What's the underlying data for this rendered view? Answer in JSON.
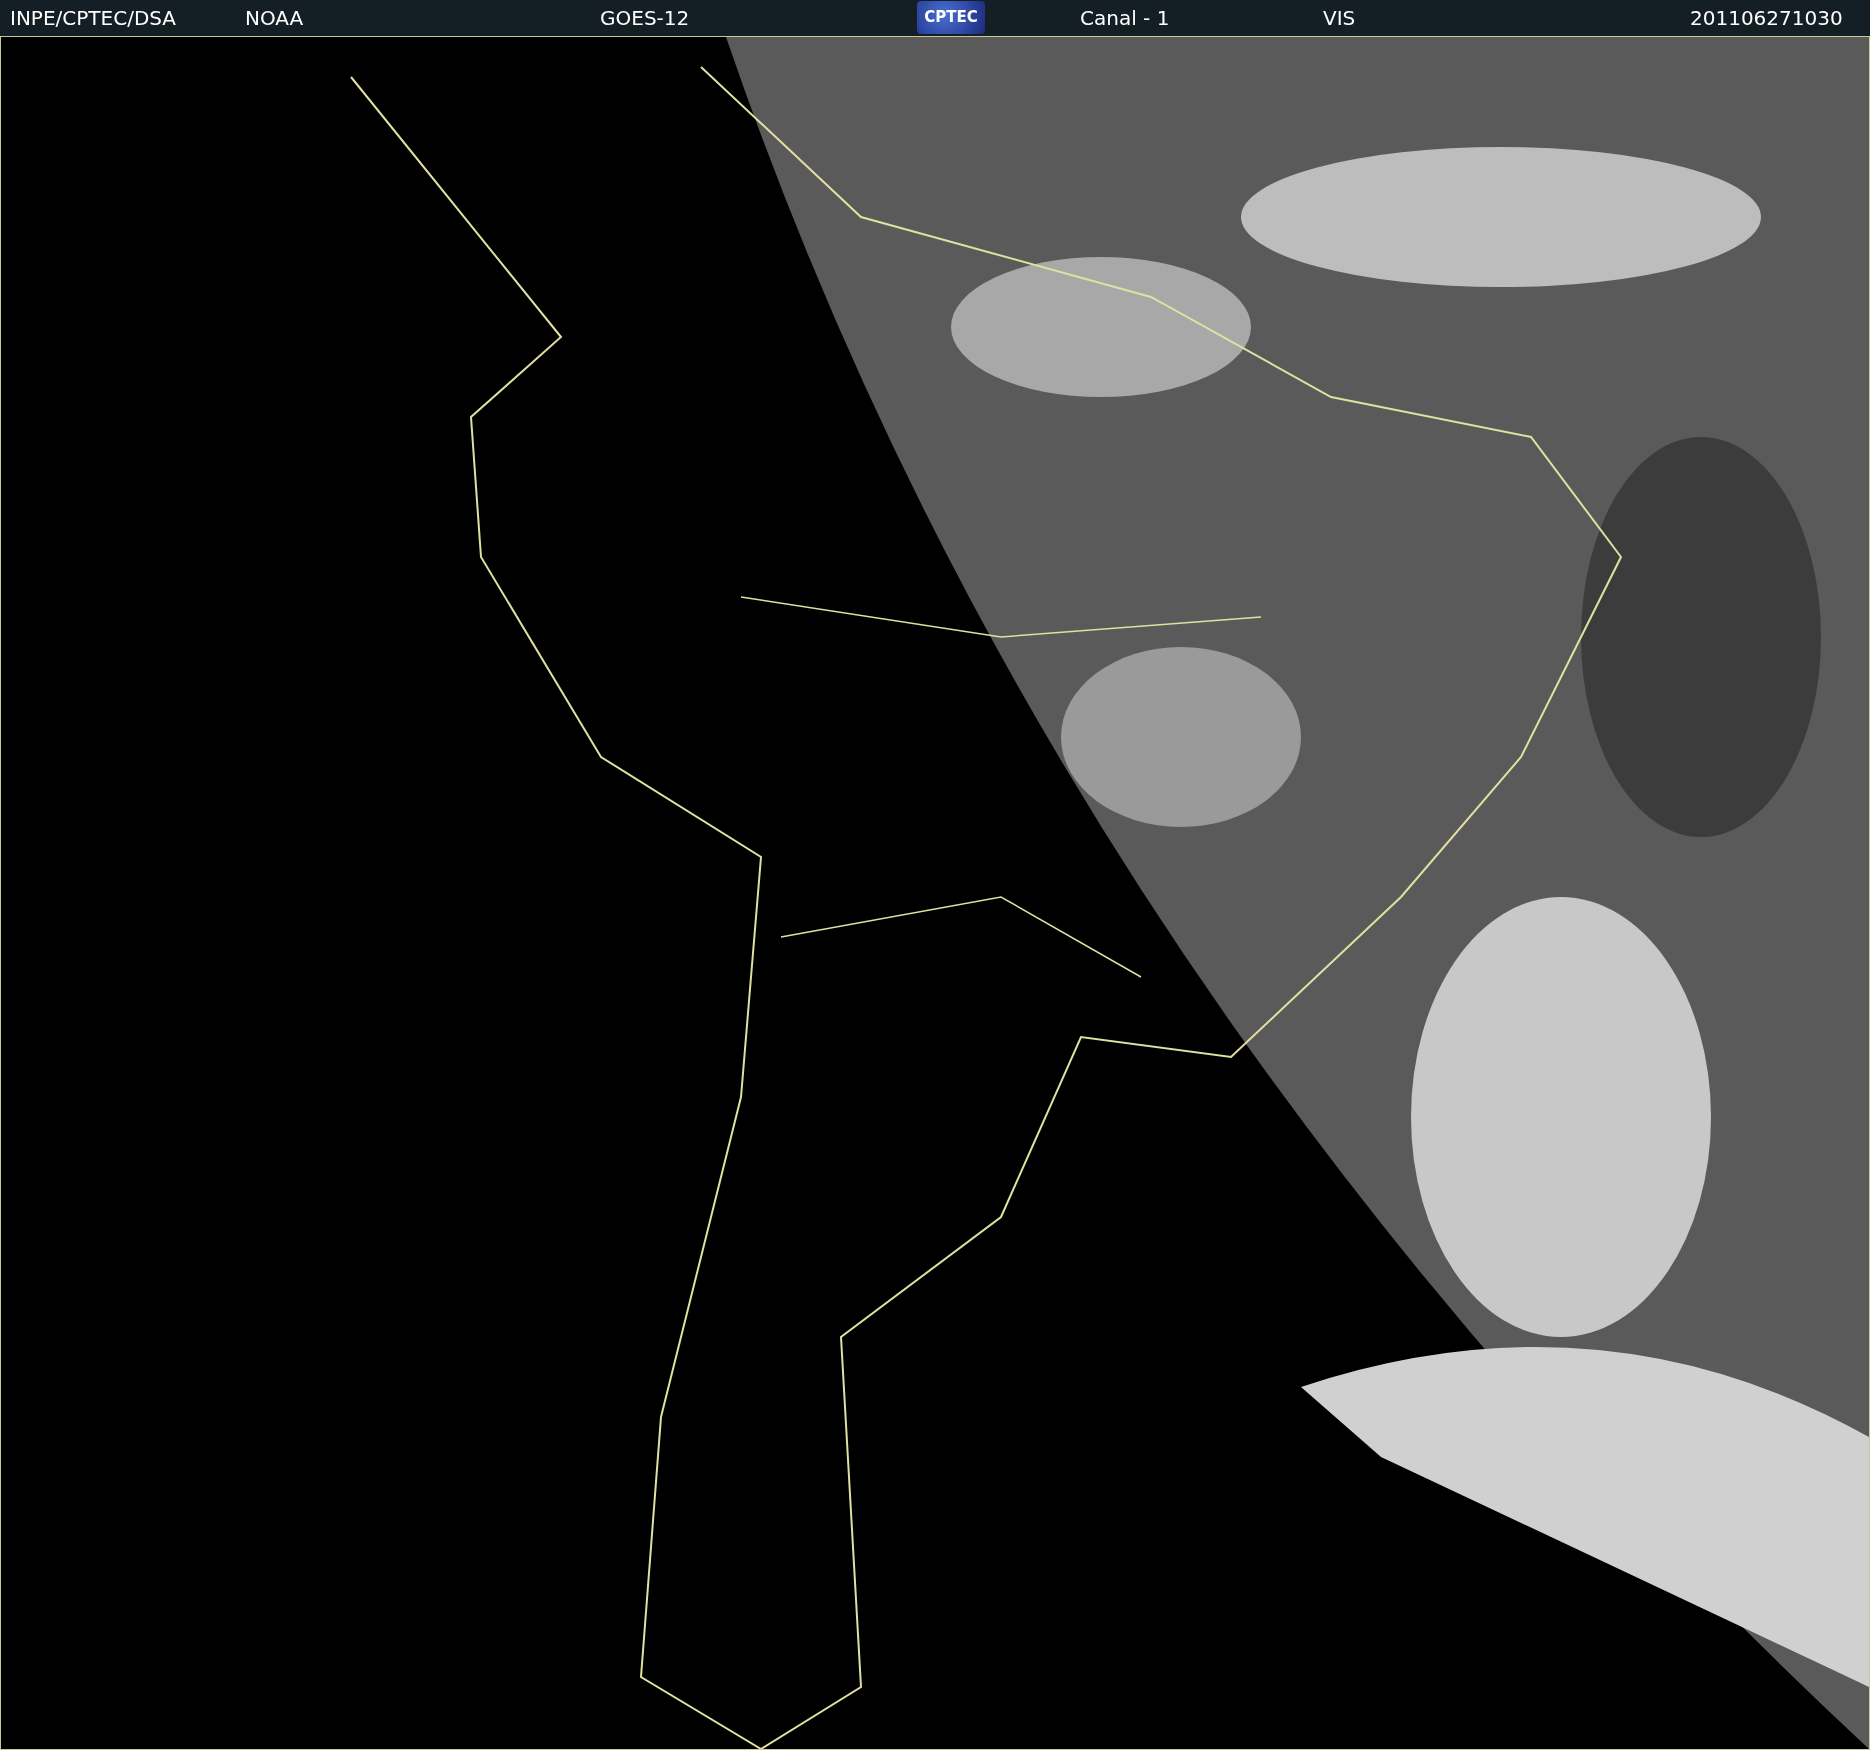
{
  "header": {
    "items": [
      {
        "text": "INPE/CPTEC/DSA"
      },
      {
        "text": "NOAA"
      },
      {
        "text": "GOES-12"
      },
      {
        "kind": "logo",
        "text": "CPTEC"
      },
      {
        "text": "Canal - 1"
      },
      {
        "text": "VIS"
      },
      {
        "text": "201106271030"
      }
    ]
  }
}
